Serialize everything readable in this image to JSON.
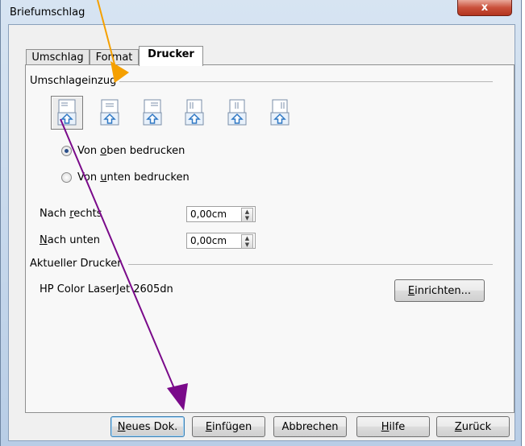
{
  "window": {
    "title": "Briefumschlag",
    "close_glyph": "x"
  },
  "tabs": [
    {
      "label": "Umschlag",
      "active": false
    },
    {
      "label": "Format",
      "active": false
    },
    {
      "label": "Drucker",
      "active": true
    }
  ],
  "feed_group": {
    "label": "Umschlageinzug",
    "options": [
      {
        "name": "feed-option-1",
        "selected": true
      },
      {
        "name": "feed-option-2",
        "selected": false
      },
      {
        "name": "feed-option-3",
        "selected": false
      },
      {
        "name": "feed-option-4",
        "selected": false
      },
      {
        "name": "feed-option-5",
        "selected": false
      },
      {
        "name": "feed-option-6",
        "selected": false
      }
    ],
    "radio_top_pre": "Von ",
    "radio_top_mnemonic": "o",
    "radio_top_post": "ben bedrucken",
    "radio_bottom_pre": "Von ",
    "radio_bottom_mnemonic": "u",
    "radio_bottom_post": "nten bedrucken",
    "selected_radio": "top"
  },
  "offset": {
    "right_pre": "Nach ",
    "right_mnemonic": "r",
    "right_post": "echts",
    "right_value": "0,00cm",
    "down_mnemonic": "N",
    "down_post": "ach unten",
    "down_value": "0,00cm"
  },
  "printer_group": {
    "label": "Aktueller Drucker",
    "printer_name": "HP Color LaserJet 2605dn",
    "setup_mnemonic": "E",
    "setup_post": "inrichten..."
  },
  "buttons": {
    "new_doc_mnemonic": "N",
    "new_doc_post": "eues Dok.",
    "insert_mnemonic": "E",
    "insert_post": "infügen",
    "cancel": "Abbrechen",
    "help_mnemonic": "H",
    "help_post": "ilfe",
    "back_mnemonic": "Z",
    "back_post": "urück"
  },
  "colors": {
    "orange_arrow": "#f5a000",
    "purple_arrow": "#7a0a8a",
    "icon_blue": "#2f78c4"
  }
}
